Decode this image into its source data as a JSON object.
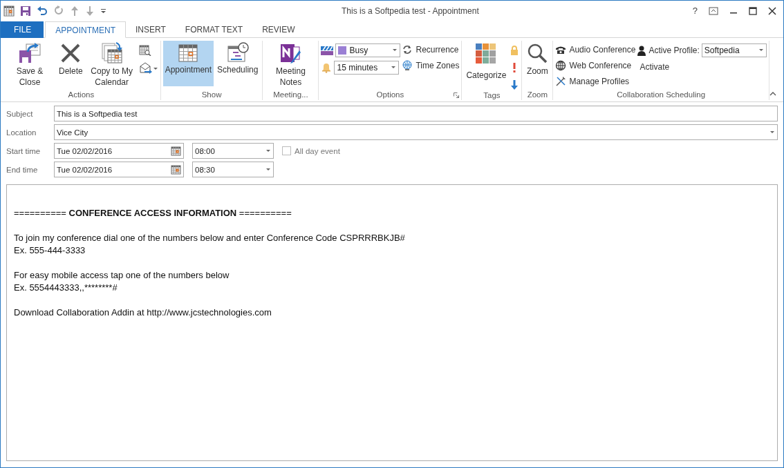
{
  "window": {
    "title": "This is a Softpedia test - Appointment",
    "help": "?"
  },
  "tabs": [
    {
      "label": "FILE",
      "kind": "file",
      "selected": false
    },
    {
      "label": "APPOINTMENT",
      "kind": "tab",
      "selected": true
    },
    {
      "label": "INSERT",
      "kind": "tab",
      "selected": false
    },
    {
      "label": "FORMAT TEXT",
      "kind": "tab",
      "selected": false
    },
    {
      "label": "REVIEW",
      "kind": "tab",
      "selected": false
    }
  ],
  "ribbon": {
    "groups": [
      {
        "label": "Actions",
        "launcher": false,
        "items": [
          {
            "kind": "large",
            "label": "Save & Close",
            "selected": false
          },
          {
            "kind": "large",
            "label": "Delete",
            "selected": false
          },
          {
            "kind": "large",
            "label": "Copy to My Calendar",
            "selected": false
          },
          {
            "kind": "column",
            "items": [
              {
                "kind": "icon"
              },
              {
                "kind": "icon"
              }
            ]
          }
        ]
      },
      {
        "label": "Show",
        "launcher": false,
        "items": [
          {
            "kind": "large",
            "label": "Appointment",
            "selected": true
          },
          {
            "kind": "large",
            "label": "Scheduling",
            "selected": false
          }
        ]
      },
      {
        "label": "Meeting...",
        "launcher": false,
        "items": [
          {
            "kind": "large",
            "label": "Meeting Notes",
            "selected": false
          }
        ]
      },
      {
        "label": "Options",
        "launcher": true,
        "items": [
          {
            "kind": "column",
            "items": [
              {
                "kind": "dropdown",
                "value": "Busy",
                "color": "#9a7fd4"
              },
              {
                "kind": "dropdown",
                "value": "15 minutes"
              }
            ]
          },
          {
            "kind": "column",
            "items": [
              {
                "kind": "small",
                "label": "Recurrence"
              },
              {
                "kind": "small",
                "label": "Time Zones"
              }
            ]
          }
        ]
      },
      {
        "label": "Tags",
        "launcher": false,
        "items": [
          {
            "kind": "large",
            "label": "Categorize",
            "selected": false
          },
          {
            "kind": "column",
            "items": [
              {
                "kind": "icon"
              },
              {
                "kind": "icon"
              },
              {
                "kind": "icon"
              }
            ]
          }
        ]
      },
      {
        "label": "Zoom",
        "launcher": false,
        "items": [
          {
            "kind": "large",
            "label": "Zoom",
            "selected": false
          }
        ]
      },
      {
        "label": "Collaboration Scheduling",
        "launcher": false,
        "items": [
          {
            "kind": "column",
            "items": [
              {
                "kind": "small",
                "label": "Audio Conference"
              },
              {
                "kind": "small",
                "label": "Web Conference"
              },
              {
                "kind": "small",
                "label": "Manage Profiles"
              }
            ]
          },
          {
            "kind": "column",
            "items": [
              {
                "kind": "combo",
                "label": "Active Profile:",
                "value": "Softpedia"
              },
              {
                "kind": "small",
                "label": "Activate"
              }
            ]
          }
        ]
      }
    ]
  },
  "form": {
    "fields": [
      {
        "label": "Subject",
        "kind": "text",
        "value": "This is a Softpedia test"
      },
      {
        "label": "Location",
        "kind": "combo",
        "value": "Vice City"
      },
      {
        "label": "Start time",
        "kind": "datetime",
        "date": "Tue 02/02/2016",
        "time": "08:00",
        "all_day": {
          "label": "All day event",
          "checked": false
        }
      },
      {
        "label": "End time",
        "kind": "datetime",
        "date": "Tue 02/02/2016",
        "time": "08:30"
      }
    ]
  },
  "body": {
    "paragraphs": [
      [
        {
          "kind": "rich",
          "text": "========== **CONFERENCE ACCESS INFORMATION** =========="
        }
      ],
      [
        {
          "kind": "plain",
          "text": "To join my conference dial one of the numbers below and enter Conference Code CSPRRRBKJB#"
        },
        {
          "kind": "plain",
          "text": "Ex. 555-444-3333"
        }
      ],
      [
        {
          "kind": "plain",
          "text": "For easy mobile access tap one of the numbers below"
        },
        {
          "kind": "plain",
          "text": "Ex. 5554443333,,********#"
        }
      ],
      [
        {
          "kind": "plain",
          "text": "Download Collaboration Addin at http://www.jcstechnologies.com"
        }
      ]
    ]
  }
}
